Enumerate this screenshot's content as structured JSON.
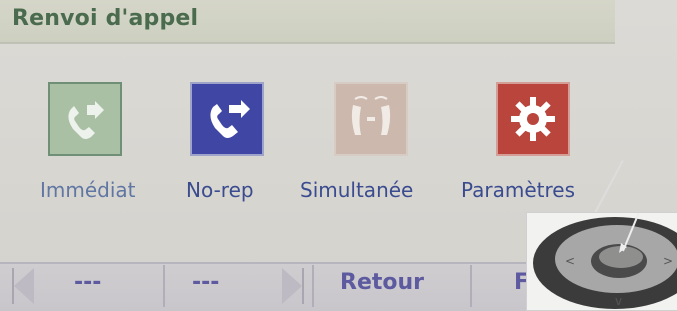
{
  "header": {
    "title": "Renvoi d'appel"
  },
  "options": [
    {
      "id": "immediate",
      "label": "Immédiat",
      "icon": "call-forward-icon"
    },
    {
      "id": "norep",
      "label": "No-rep",
      "icon": "call-forward-noanswer-icon"
    },
    {
      "id": "simul",
      "label": "Simultanée",
      "icon": "dual-ring-icon"
    },
    {
      "id": "params",
      "label": "Paramètres",
      "icon": "gear-icon"
    }
  ],
  "softkeys": {
    "key1": "---",
    "key2": "---",
    "key3": "Retour",
    "key4": "F"
  },
  "colors": {
    "title": "#4a6b4e",
    "label": "#3a4c8f",
    "softkey": "#5d5aa0"
  }
}
